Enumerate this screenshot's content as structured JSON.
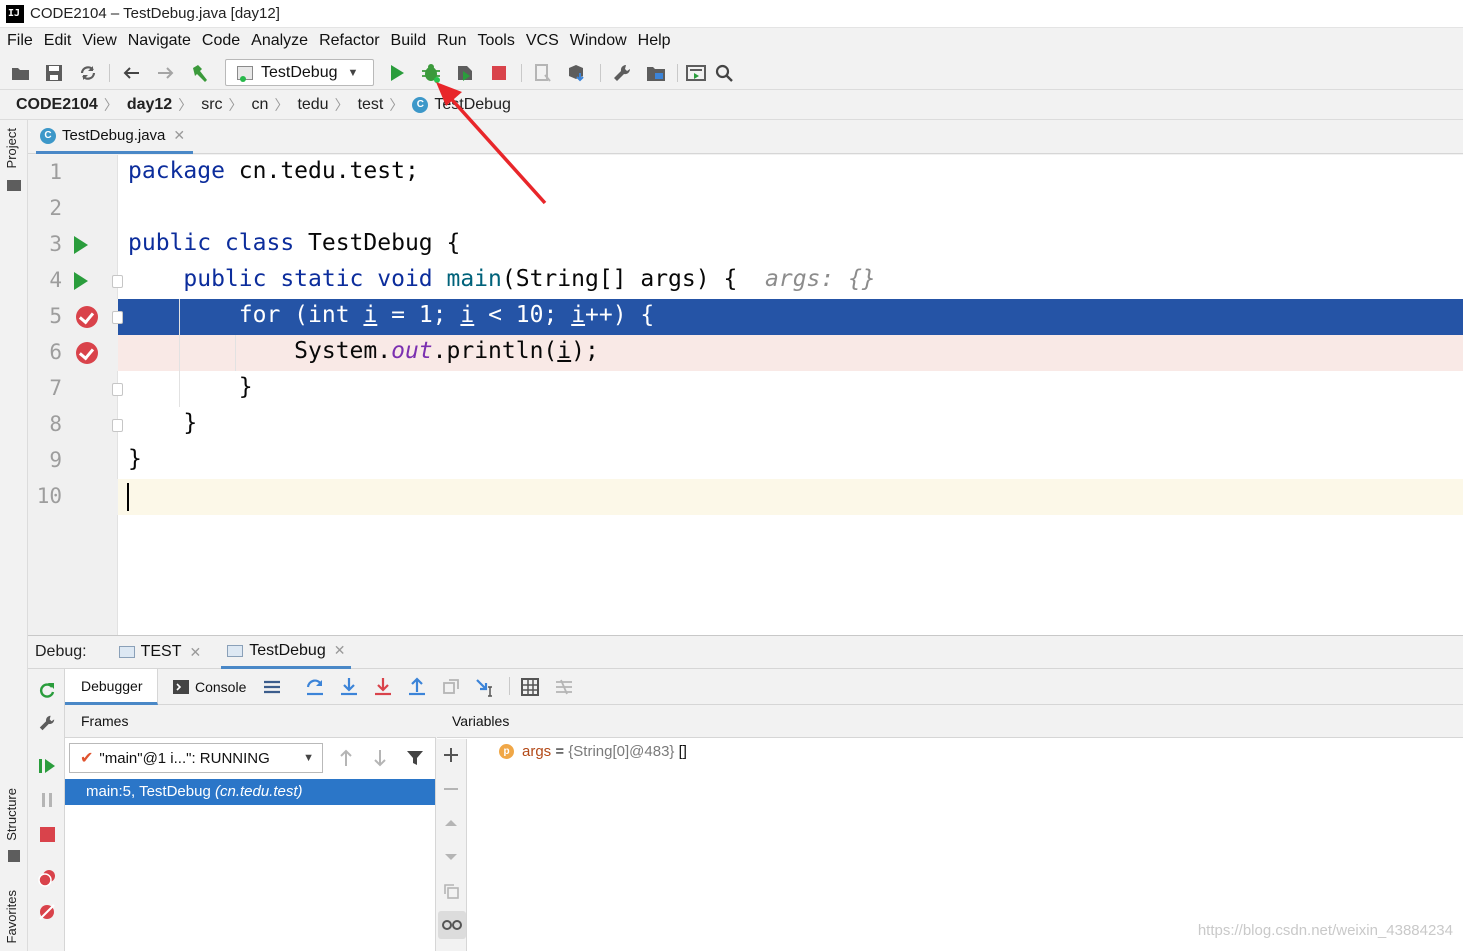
{
  "window": {
    "title": "CODE2104 – TestDebug.java [day12]"
  },
  "menu": [
    "File",
    "Edit",
    "View",
    "Navigate",
    "Code",
    "Analyze",
    "Refactor",
    "Build",
    "Run",
    "Tools",
    "VCS",
    "Window",
    "Help"
  ],
  "toolbar": {
    "run_config": "TestDebug"
  },
  "breadcrumb": [
    "CODE2104",
    "day12",
    "src",
    "cn",
    "tedu",
    "test",
    "TestDebug"
  ],
  "side_tabs": {
    "project": "Project",
    "structure": "Structure",
    "favorites": "Favorites"
  },
  "editor": {
    "tab": "TestDebug.java",
    "line_numbers": [
      "1",
      "2",
      "3",
      "4",
      "5",
      "6",
      "7",
      "8",
      "9",
      "10"
    ],
    "code": {
      "l1_kw": "package",
      "l1_rest": " cn.tedu.test;",
      "l3_kw": "public class",
      "l3_rest": " TestDebug {",
      "l4_kw": "public static void",
      "l4_fn": " main",
      "l4_rest": "(String[] args) {",
      "l4_hint": "args: {}",
      "l5_a": "for (",
      "l5_kw": "int",
      "l5_b": " ",
      "l5_v1": "i",
      "l5_c": " = 1; ",
      "l5_v2": "i",
      "l5_d": " < 10; ",
      "l5_v3": "i",
      "l5_e": "++) {",
      "l6_a": "System.",
      "l6_out": "out",
      "l6_b": ".println(",
      "l6_v": "i",
      "l6_c": ");",
      "l7": "}",
      "l8": "}",
      "l9": "}"
    }
  },
  "debug": {
    "label": "Debug:",
    "tabs": [
      "TEST",
      "TestDebug"
    ],
    "debugger_tab": "Debugger",
    "console_tab": "Console",
    "frames_title": "Frames",
    "thread": "\"main\"@1 i...\": RUNNING",
    "frame": "main:5, TestDebug",
    "frame_pkg": "(cn.tedu.test)",
    "variables_title": "Variables",
    "var": {
      "badge": "p",
      "name": "args",
      "eq": " = ",
      "value": "{String[0]@483}",
      "extra": " []"
    }
  },
  "watermark": "https://blog.csdn.net/weixin_43884234",
  "colors": {
    "exec_line": "#2554a6",
    "breakpoint_line": "#f9e9e6",
    "selected_frame": "#2b76c8",
    "keyword": "#0c2d9c",
    "run_green": "#2a9d3c",
    "annotation_arrow": "#e8262a"
  }
}
